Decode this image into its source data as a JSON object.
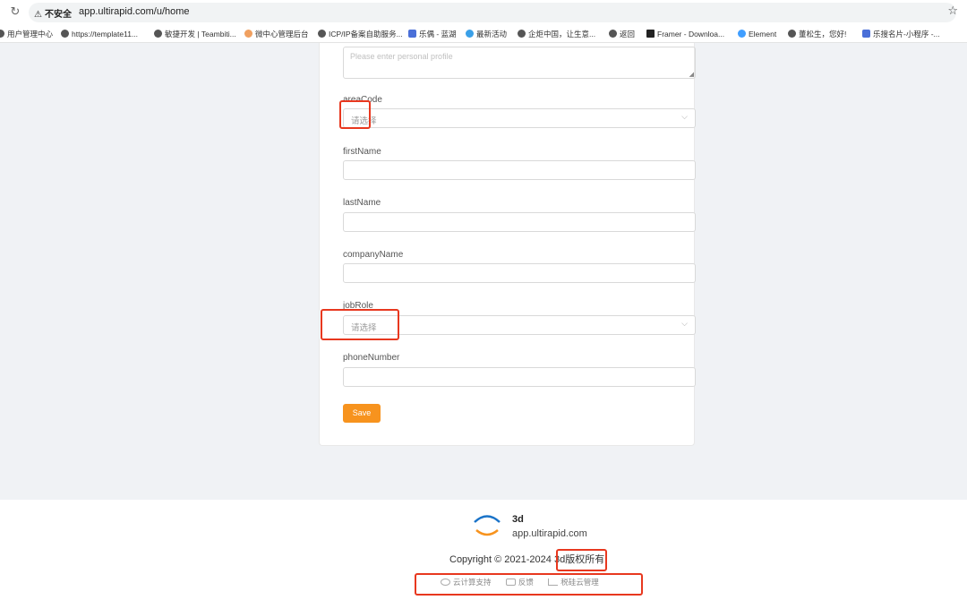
{
  "browser": {
    "security_label": "不安全",
    "url": "app.ultirapid.com/u/home",
    "bookmarks": [
      "用户管理中心",
      "https://template11...",
      "敏捷开发 | Teambiti...",
      "微中心管理后台",
      "ICP/IP备案自助服务...",
      "乐偶 - 蓝湖",
      "最新活动",
      "企炬中国，让生意...",
      "返回",
      "Framer - Downloa...",
      "Element",
      "董松生，您好!",
      "乐搜名片-小程序 -..."
    ]
  },
  "form": {
    "profile_placeholder": "Please enter personal profile",
    "areaCode_label": "areaCode",
    "areaCode_value": "请选择",
    "firstName_label": "firstName",
    "lastName_label": "lastName",
    "companyName_label": "companyName",
    "jobRole_label": "jobRole",
    "jobRole_value": "请选择",
    "phoneNumber_label": "phoneNumber",
    "save_label": "Save"
  },
  "footer": {
    "brand": "3d",
    "domain": "app.ultirapid.com",
    "copyright": "Copyright © 2021-2024 3d版权所有",
    "links": [
      "云计算支持",
      "反馈",
      "税硅云管理"
    ]
  },
  "colors": {
    "accent": "#f7931e",
    "highlight": "#e8381f"
  }
}
